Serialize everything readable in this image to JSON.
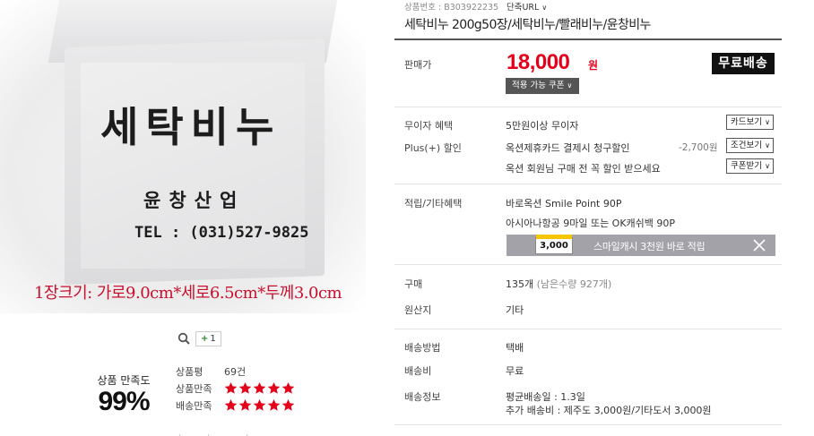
{
  "product_image": {
    "box_title": "세탁비누",
    "box_company": "윤창산업",
    "box_tel": "TEL : (031)527-9825",
    "size_caption": "1장크기: 가로9.0cm*세로6.5cm*두께3.0cm"
  },
  "image_tools": {
    "zoom_icon": "magnifier-icon",
    "plus_label": "+",
    "plus_count": "1"
  },
  "satisfaction": {
    "label": "상품 만족도",
    "percent": "99%"
  },
  "ratings": {
    "review_label": "상품평",
    "review_count": "69건",
    "product_label": "상품만족",
    "product_stars": 5,
    "delivery_label": "배송만족",
    "delivery_stars": 5,
    "star_color": "#e4001a"
  },
  "header": {
    "product_no_label": "상품번호 : B303922235",
    "short_url_label": "단축URL"
  },
  "title": "세탁비누 200g50장/세탁비누/빨래비누/윤창비누",
  "price": {
    "label": "판매가",
    "amount": "18,000",
    "unit": "원",
    "free_shipping_badge": "무료배송",
    "coupon_button": "적용 가능 쿠폰"
  },
  "benefits": {
    "interest_free_label": "무이자 혜택",
    "interest_free_value": "5만원이상 무이자",
    "card_button": "카드보기",
    "plus_discount_label": "Plus(+) 할인",
    "card_discount_text": "옥션제휴카드 결제시 청구할인",
    "card_discount_amount": "-2,700원",
    "condition_button": "조건보기",
    "member_coupon_text": "옥션 회원님 구매 전 꼭 할인 받으세요",
    "coupon_receive_button": "쿠폰받기"
  },
  "points": {
    "label": "적립/기타혜택",
    "smile_point": "바로옥션 Smile Point 90P",
    "asiana": "아시아나항공 9마일 또는 OK캐쉬백 90P",
    "banner_coin": "3,000",
    "banner_text": "스마일캐시 3천원 바로 적립"
  },
  "purchase": {
    "label": "구매",
    "count": "135개",
    "remaining": "(남은수량 927개)"
  },
  "origin": {
    "label": "원산지",
    "value": "기타"
  },
  "shipping": {
    "method_label": "배송방법",
    "method_value": "택배",
    "fee_label": "배송비",
    "fee_value": "무료",
    "info_label": "배송정보",
    "info_line1": "평균배송일 : 1.3일",
    "info_line2": "추가 배송비 : 제주도 3,000원/기타도서 3,000원"
  }
}
